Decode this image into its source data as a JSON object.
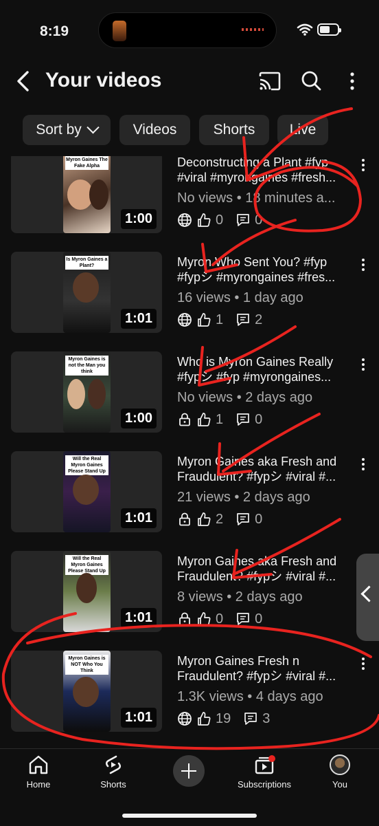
{
  "status": {
    "time": "8:19"
  },
  "header": {
    "title": "Your videos"
  },
  "chips": [
    {
      "label": "Sort by"
    },
    {
      "label": "Videos"
    },
    {
      "label": "Shorts"
    },
    {
      "label": "Live"
    }
  ],
  "videos": [
    {
      "title_line1": "Deconstructing a Plant #fyp",
      "title_line2": "#viral #myrongaines #fresh...",
      "meta": "No views • 18 minutes a...",
      "visibility": "globe-icon",
      "likes": "0",
      "comments": "0",
      "duration": "1:00",
      "thumb_caption": "Myron Gaines The Fake Alpha"
    },
    {
      "title_line1": "Myron Who Sent You? #fyp",
      "title_line2": "#fypシ #myrongaines #fres...",
      "meta": "16 views • 1 day ago",
      "visibility": "globe-icon",
      "likes": "1",
      "comments": "2",
      "duration": "1:01",
      "thumb_caption": "Is Myron Gaines a Plant?"
    },
    {
      "title_line1": "Who is Myron Gaines Really",
      "title_line2": "#fypシ #fyp #myrongaines...",
      "meta": "No views • 2 days ago",
      "visibility": "lock-icon",
      "likes": "1",
      "comments": "0",
      "duration": "1:00",
      "thumb_caption": "Myron Gaines is not the Man you think"
    },
    {
      "title_line1": "Myron Gaines aka Fresh and",
      "title_line2": "Fraudulent? #fypシ #viral #...",
      "meta": "21 views • 2 days ago",
      "visibility": "lock-icon",
      "likes": "2",
      "comments": "0",
      "duration": "1:01",
      "thumb_caption": "Will the Real Myron Gaines Please Stand Up"
    },
    {
      "title_line1": "Myron Gaines aka Fresh and",
      "title_line2": "Fraudulent? #fypシ #viral #...",
      "meta": "8 views • 2 days ago",
      "visibility": "lock-icon",
      "likes": "0",
      "comments": "0",
      "duration": "1:01",
      "thumb_caption": "Will the Real Myron Gaines Please Stand Up"
    },
    {
      "title_line1": "Myron Gaines Fresh n",
      "title_line2": "Fraudulent? #fypシ #viral #...",
      "meta": "1.3K views • 4 days ago",
      "visibility": "globe-icon",
      "likes": "19",
      "comments": "3",
      "duration": "1:01",
      "thumb_caption": "Myron Gaines is NOT Who You Think"
    }
  ],
  "nav": [
    {
      "label": "Home"
    },
    {
      "label": "Shorts"
    },
    {
      "label": "Subscriptions"
    },
    {
      "label": "You"
    }
  ],
  "colors": {
    "background": "#0f0f0f",
    "chip": "#272727",
    "annotation": "#e8231f",
    "text_secondary": "#aaaaaa"
  }
}
